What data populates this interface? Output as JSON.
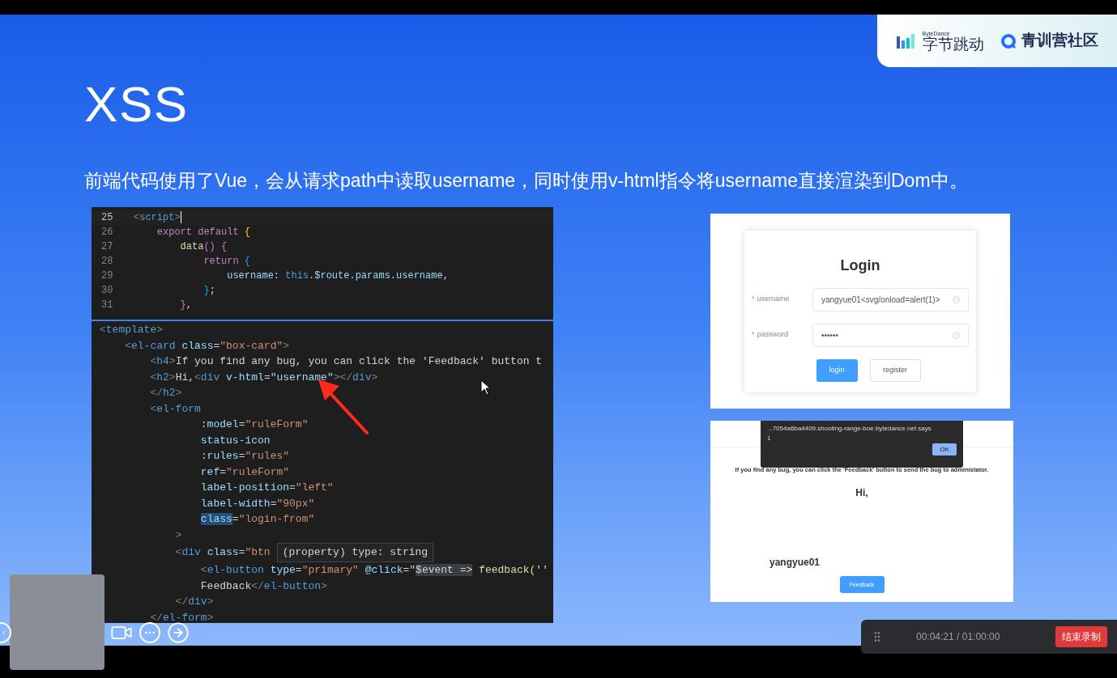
{
  "logos": [
    {
      "kind": "bytedance",
      "caption": "ByteDance",
      "name": "字节跳动"
    },
    {
      "kind": "camp",
      "name": "青训营社区"
    }
  ],
  "slide": {
    "title": "XSS",
    "subtitle": "前端代码使用了Vue，会从请求path中读取username，同时使用v-html指令将username直接渲染到Dom中。"
  },
  "script_editor": {
    "lines": [
      {
        "number": "25",
        "current": true,
        "tokens": [
          {
            "text": "<",
            "kind": "punct"
          },
          {
            "text": "script",
            "kind": "tag"
          },
          {
            "text": ">",
            "kind": "punct"
          }
        ]
      },
      {
        "number": "26",
        "current": false,
        "tokens": [
          {
            "text": "    export default",
            "kind": "keyword"
          },
          {
            "text": " {",
            "kind": "brace1"
          }
        ]
      },
      {
        "number": "27",
        "current": false,
        "tokens": [
          {
            "text": "        data",
            "kind": "func"
          },
          {
            "text": "() {",
            "kind": "brace2"
          }
        ]
      },
      {
        "number": "28",
        "current": false,
        "tokens": [
          {
            "text": "            return",
            "kind": "keyword"
          },
          {
            "text": " {",
            "kind": "brace3"
          }
        ]
      },
      {
        "number": "29",
        "current": false,
        "tokens": [
          {
            "text": "                username: ",
            "kind": "attr"
          },
          {
            "text": "this",
            "kind": "tag"
          },
          {
            "text": ".$route.params.username,",
            "kind": "attr"
          }
        ]
      },
      {
        "number": "30",
        "current": false,
        "tokens": [
          {
            "text": "            }",
            "kind": "brace3"
          },
          {
            "text": ";",
            "kind": "plain"
          }
        ]
      },
      {
        "number": "31",
        "current": false,
        "tokens": [
          {
            "text": "        }",
            "kind": "brace2"
          },
          {
            "text": ",",
            "kind": "plain"
          }
        ]
      }
    ]
  },
  "template_editor": {
    "tooltip": "(property) type: string",
    "lines": [
      {
        "tokens": [
          {
            "text": "<",
            "kind": "punct"
          },
          {
            "text": "template",
            "kind": "tag"
          },
          {
            "text": ">",
            "kind": "punct"
          }
        ]
      },
      {
        "tokens": [
          {
            "text": "    <",
            "kind": "punct"
          },
          {
            "text": "el-card",
            "kind": "tag"
          },
          {
            "text": " class",
            "kind": "attr"
          },
          {
            "text": "=",
            "kind": "plain"
          },
          {
            "text": "\"box-card\"",
            "kind": "string"
          },
          {
            "text": ">",
            "kind": "punct"
          }
        ]
      },
      {
        "tokens": [
          {
            "text": "        <",
            "kind": "punct"
          },
          {
            "text": "h4",
            "kind": "tag"
          },
          {
            "text": ">",
            "kind": "punct"
          },
          {
            "text": "If you find any bug, you can click the 'Feedback' button t",
            "kind": "plain"
          }
        ]
      },
      {
        "tokens": [
          {
            "text": "        <",
            "kind": "punct"
          },
          {
            "text": "h2",
            "kind": "tag"
          },
          {
            "text": ">",
            "kind": "punct"
          },
          {
            "text": "Hi,",
            "kind": "plain"
          },
          {
            "text": "<",
            "kind": "punct"
          },
          {
            "text": "div",
            "kind": "tag"
          },
          {
            "text": " v-html",
            "kind": "attr"
          },
          {
            "text": "=",
            "kind": "plain"
          },
          {
            "text": "\"username\"",
            "kind": "attr"
          },
          {
            "text": "></",
            "kind": "punct"
          },
          {
            "text": "div",
            "kind": "tag"
          },
          {
            "text": ">",
            "kind": "punct"
          }
        ]
      },
      {
        "tokens": [
          {
            "text": "        </",
            "kind": "punct"
          },
          {
            "text": "h2",
            "kind": "tag"
          },
          {
            "text": ">",
            "kind": "punct"
          }
        ]
      },
      {
        "tokens": [
          {
            "text": "        <",
            "kind": "punct"
          },
          {
            "text": "el-form",
            "kind": "tag"
          }
        ]
      },
      {
        "tokens": [
          {
            "text": "                :model",
            "kind": "attr"
          },
          {
            "text": "=",
            "kind": "plain"
          },
          {
            "text": "\"ruleForm\"",
            "kind": "string"
          }
        ]
      },
      {
        "tokens": [
          {
            "text": "                status-icon",
            "kind": "attr"
          }
        ]
      },
      {
        "tokens": [
          {
            "text": "                :rules",
            "kind": "attr"
          },
          {
            "text": "=",
            "kind": "plain"
          },
          {
            "text": "\"rules\"",
            "kind": "string"
          }
        ]
      },
      {
        "tokens": [
          {
            "text": "                ref",
            "kind": "attr"
          },
          {
            "text": "=",
            "kind": "plain"
          },
          {
            "text": "\"ruleForm\"",
            "kind": "string"
          }
        ]
      },
      {
        "tokens": [
          {
            "text": "                label-position",
            "kind": "attr"
          },
          {
            "text": "=",
            "kind": "plain"
          },
          {
            "text": "\"left\"",
            "kind": "string"
          }
        ]
      },
      {
        "tokens": [
          {
            "text": "                label-width",
            "kind": "attr"
          },
          {
            "text": "=",
            "kind": "plain"
          },
          {
            "text": "\"90px\"",
            "kind": "string"
          }
        ]
      },
      {
        "tokens": [
          {
            "text": "                class",
            "kind": "selected"
          },
          {
            "text": "=",
            "kind": "plain"
          },
          {
            "text": "\"login-from\"",
            "kind": "string"
          }
        ]
      },
      {
        "tokens": [
          {
            "text": "            >",
            "kind": "punct"
          }
        ]
      },
      {
        "tokens": [
          {
            "text": "            <",
            "kind": "punct"
          },
          {
            "text": "div",
            "kind": "tag"
          },
          {
            "text": " class",
            "kind": "attr"
          },
          {
            "text": "=",
            "kind": "plain"
          },
          {
            "text": "\"btn",
            "kind": "string"
          }
        ],
        "has_tooltip": true
      },
      {
        "tokens": [
          {
            "text": "                <",
            "kind": "punct"
          },
          {
            "text": "el-button",
            "kind": "tag"
          },
          {
            "text": " type",
            "kind": "attr"
          },
          {
            "text": "=",
            "kind": "plain"
          },
          {
            "text": "\"primary\"",
            "kind": "string"
          },
          {
            "text": " @click",
            "kind": "attr"
          },
          {
            "text": "=\"",
            "kind": "plain"
          },
          {
            "text": "$event =>",
            "kind": "hover"
          },
          {
            "text": " feedback(''",
            "kind": "func"
          }
        ]
      },
      {
        "tokens": [
          {
            "text": "                Feedback",
            "kind": "plain"
          },
          {
            "text": "</",
            "kind": "punct"
          },
          {
            "text": "el-button",
            "kind": "tag"
          },
          {
            "text": ">",
            "kind": "punct"
          }
        ]
      },
      {
        "tokens": [
          {
            "text": "            </",
            "kind": "punct"
          },
          {
            "text": "div",
            "kind": "tag"
          },
          {
            "text": ">",
            "kind": "punct"
          }
        ]
      },
      {
        "tokens": [
          {
            "text": "        </",
            "kind": "punct"
          },
          {
            "text": "el-form",
            "kind": "tag"
          },
          {
            "text": ">",
            "kind": "punct"
          }
        ]
      }
    ]
  },
  "login_screenshot": {
    "title": "Login",
    "fields": [
      {
        "label": "username",
        "value": "yangyue01<svg/onload=alert(1)>",
        "required": true,
        "required_mark": "*"
      },
      {
        "label": "password",
        "value": "••••••",
        "required": true,
        "required_mark": "*"
      }
    ],
    "buttons": [
      {
        "label": "login",
        "primary": true
      },
      {
        "label": "register",
        "primary": false
      }
    ]
  },
  "alert_screenshot": {
    "dialog": {
      "message": "...7054a6ba4409.shooting-range-boe.bytedance.net says",
      "value": "1",
      "ok": "OK"
    },
    "notice": "If you find any bug, you can click the 'Feedback' button to send the bug to administator.",
    "greeting": "Hi,",
    "username": "yangyue01",
    "button": "Feedback"
  },
  "recording_bar": {
    "time": "00:04:21 / 01:00:00",
    "stop_button": "结束录制"
  }
}
